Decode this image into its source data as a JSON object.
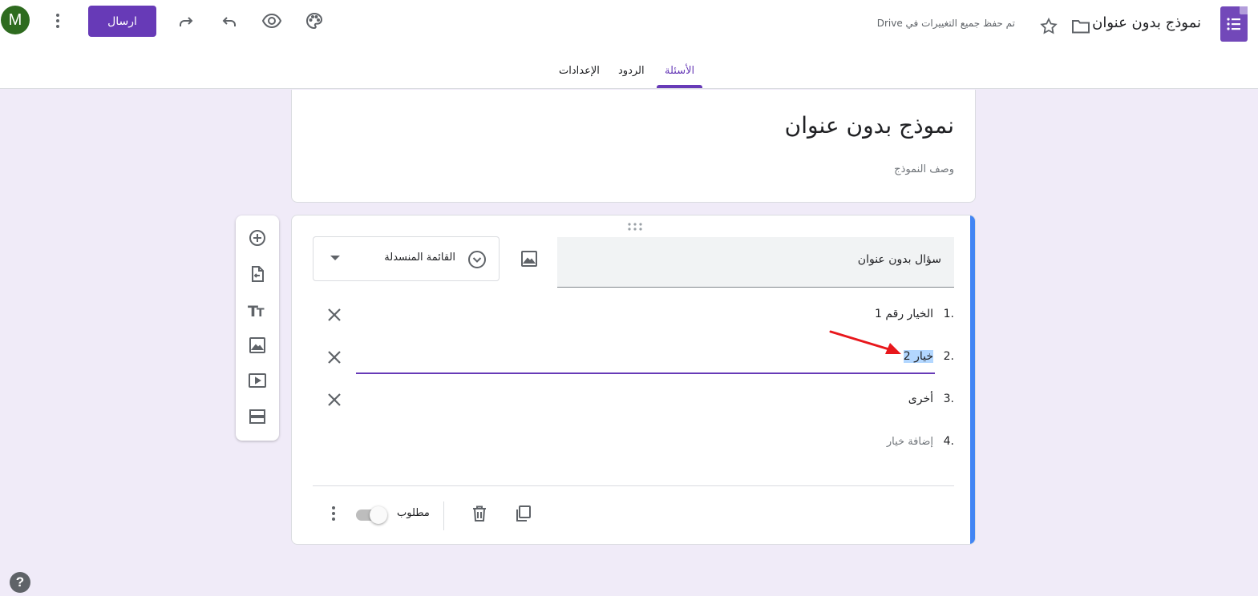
{
  "header": {
    "doc_title": "نموذج بدون عنوان",
    "saved_status": "تم حفظ جميع التغييرات في Drive",
    "send_label": "ارسال",
    "avatar_letter": "M"
  },
  "tabs": [
    {
      "label": "الأسئلة",
      "active": true
    },
    {
      "label": "الردود",
      "active": false
    },
    {
      "label": "الإعدادات",
      "active": false
    }
  ],
  "form": {
    "title": "نموذج بدون عنوان",
    "description": "وصف النموذج"
  },
  "question": {
    "title": "سؤال بدون عنوان",
    "type_label": "القائمة المنسدلة",
    "options": [
      {
        "num": "1.",
        "text": "الخيار رقم 1"
      },
      {
        "num": "2.",
        "text": "خيار 2"
      },
      {
        "num": "3.",
        "text": "أخرى"
      }
    ],
    "add_option": {
      "num": "4.",
      "text": "إضافة خيار"
    },
    "required_label": "مطلوب"
  },
  "colors": {
    "accent": "#673ab7",
    "focus_bar": "#4285f4",
    "background": "#f0ebf8",
    "annotation": "#e8171c"
  }
}
